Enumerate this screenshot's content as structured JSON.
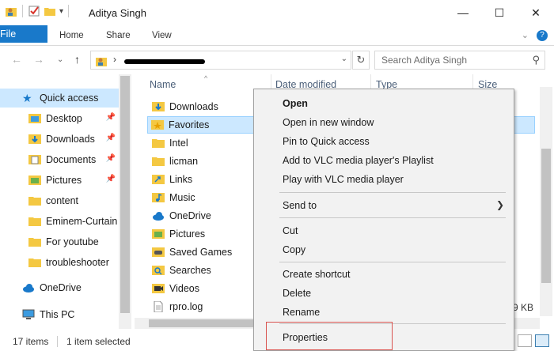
{
  "window": {
    "title": "Aditya Singh",
    "controls": {
      "minimize": "—",
      "maximize": "☐",
      "close": "✕"
    }
  },
  "ribbon": {
    "tabs": [
      "File",
      "Home",
      "Share",
      "View"
    ],
    "collapse_icon": "chevron-down-icon",
    "help_icon": "?"
  },
  "address": {
    "chevron": "›",
    "search_placeholder": "Search Aditya Singh"
  },
  "nav": {
    "items": [
      {
        "label": "Quick access",
        "icon": "star-icon",
        "selected": true
      },
      {
        "label": "Desktop",
        "icon": "folder-desktop-icon",
        "pinned": true
      },
      {
        "label": "Downloads",
        "icon": "folder-download-icon",
        "pinned": true
      },
      {
        "label": "Documents",
        "icon": "folder-documents-icon",
        "pinned": true
      },
      {
        "label": "Pictures",
        "icon": "folder-pictures-icon",
        "pinned": true
      },
      {
        "label": "content",
        "icon": "folder-icon"
      },
      {
        "label": "Eminem-Curtain",
        "icon": "folder-icon"
      },
      {
        "label": "For youtube",
        "icon": "folder-icon"
      },
      {
        "label": "troubleshooter",
        "icon": "folder-icon"
      },
      {
        "label": "OneDrive",
        "icon": "cloud-icon"
      },
      {
        "label": "This PC",
        "icon": "computer-icon"
      }
    ]
  },
  "columns": [
    "Name",
    "Date modified",
    "Type",
    "Size"
  ],
  "files": [
    {
      "name": "Downloads",
      "icon": "folder-download-icon"
    },
    {
      "name": "Favorites",
      "icon": "folder-star-icon",
      "selected": true
    },
    {
      "name": "Intel",
      "icon": "folder-icon"
    },
    {
      "name": "licman",
      "icon": "folder-icon"
    },
    {
      "name": "Links",
      "icon": "folder-links-icon"
    },
    {
      "name": "Music",
      "icon": "folder-music-icon"
    },
    {
      "name": "OneDrive",
      "icon": "cloud-icon"
    },
    {
      "name": "Pictures",
      "icon": "folder-pictures-icon"
    },
    {
      "name": "Saved Games",
      "icon": "folder-games-icon"
    },
    {
      "name": "Searches",
      "icon": "folder-search-icon"
    },
    {
      "name": "Videos",
      "icon": "folder-videos-icon"
    },
    {
      "name": "rpro.log",
      "icon": "file-icon"
    }
  ],
  "size_tail": "9 KB",
  "status": {
    "count": "17 items",
    "selection": "1 item selected"
  },
  "context_menu": {
    "groups": [
      [
        {
          "label": "Open",
          "bold": true
        },
        {
          "label": "Open in new window"
        },
        {
          "label": "Pin to Quick access"
        },
        {
          "label": "Add to VLC media player's Playlist"
        },
        {
          "label": "Play with VLC media player"
        }
      ],
      [
        {
          "label": "Send to",
          "submenu": true
        }
      ],
      [
        {
          "label": "Cut"
        },
        {
          "label": "Copy"
        }
      ],
      [
        {
          "label": "Create shortcut"
        },
        {
          "label": "Delete"
        },
        {
          "label": "Rename"
        }
      ],
      [
        {
          "label": "Properties",
          "highlighted": true
        }
      ]
    ]
  },
  "colors": {
    "accent": "#1979ca",
    "selection": "#cce8ff",
    "highlight_border": "#d9534f",
    "folder": "#f4c842"
  }
}
